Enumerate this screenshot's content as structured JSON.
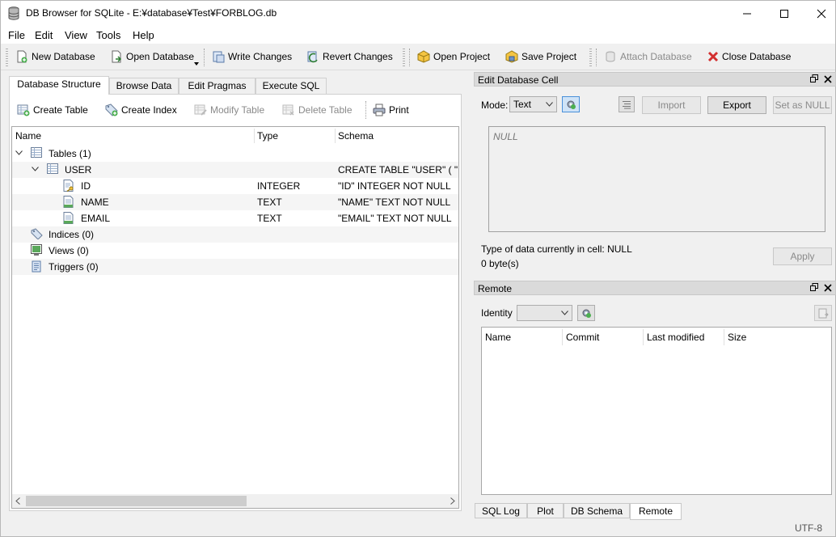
{
  "window": {
    "title": "DB Browser for SQLite - E:¥database¥Test¥FORBLOG.db"
  },
  "menu": [
    {
      "label": "File",
      "key": "F"
    },
    {
      "label": "Edit",
      "key": "E"
    },
    {
      "label": "View",
      "key": "V"
    },
    {
      "label": "Tools",
      "key": "T"
    },
    {
      "label": "Help",
      "key": "H"
    }
  ],
  "toolbar": {
    "new_database": "New Database",
    "open_database": "Open Database",
    "write_changes": "Write Changes",
    "revert_changes": "Revert Changes",
    "open_project": "Open Project",
    "save_project": "Save Project",
    "attach_database": "Attach Database",
    "close_database": "Close Database"
  },
  "tabs": [
    "Database Structure",
    "Browse Data",
    "Edit Pragmas",
    "Execute SQL"
  ],
  "structure_toolbar": {
    "create_table": "Create Table",
    "create_index": "Create Index",
    "modify_table": "Modify Table",
    "delete_table": "Delete Table",
    "print": "Print"
  },
  "tree": {
    "columns": [
      "Name",
      "Type",
      "Schema"
    ],
    "rows": [
      {
        "name": "Tables (1)",
        "type": "",
        "schema": ""
      },
      {
        "name": "USER",
        "type": "",
        "schema": "CREATE TABLE \"USER\" ( \"ID\""
      },
      {
        "name": "ID",
        "type": "INTEGER",
        "schema": "\"ID\" INTEGER NOT NULL"
      },
      {
        "name": "NAME",
        "type": "TEXT",
        "schema": "\"NAME\" TEXT NOT NULL"
      },
      {
        "name": "EMAIL",
        "type": "TEXT",
        "schema": "\"EMAIL\" TEXT NOT NULL"
      },
      {
        "name": "Indices (0)",
        "type": "",
        "schema": ""
      },
      {
        "name": "Views (0)",
        "type": "",
        "schema": ""
      },
      {
        "name": "Triggers (0)",
        "type": "",
        "schema": ""
      }
    ]
  },
  "edit_cell": {
    "title": "Edit Database Cell",
    "mode_label": "Mode:",
    "mode_value": "Text",
    "import": "Import",
    "export": "Export",
    "set_as_null": "Set as NULL",
    "cell_value": "NULL",
    "type_info": "Type of data currently in cell: NULL",
    "size_info": "0 byte(s)",
    "apply": "Apply"
  },
  "remote": {
    "title": "Remote",
    "identity_label": "Identity",
    "identity_value": "",
    "columns": [
      "Name",
      "Commit",
      "Last modified",
      "Size"
    ]
  },
  "bottom_tabs": [
    "SQL Log",
    "Plot",
    "DB Schema",
    "Remote"
  ],
  "status": {
    "encoding": "UTF-8"
  }
}
